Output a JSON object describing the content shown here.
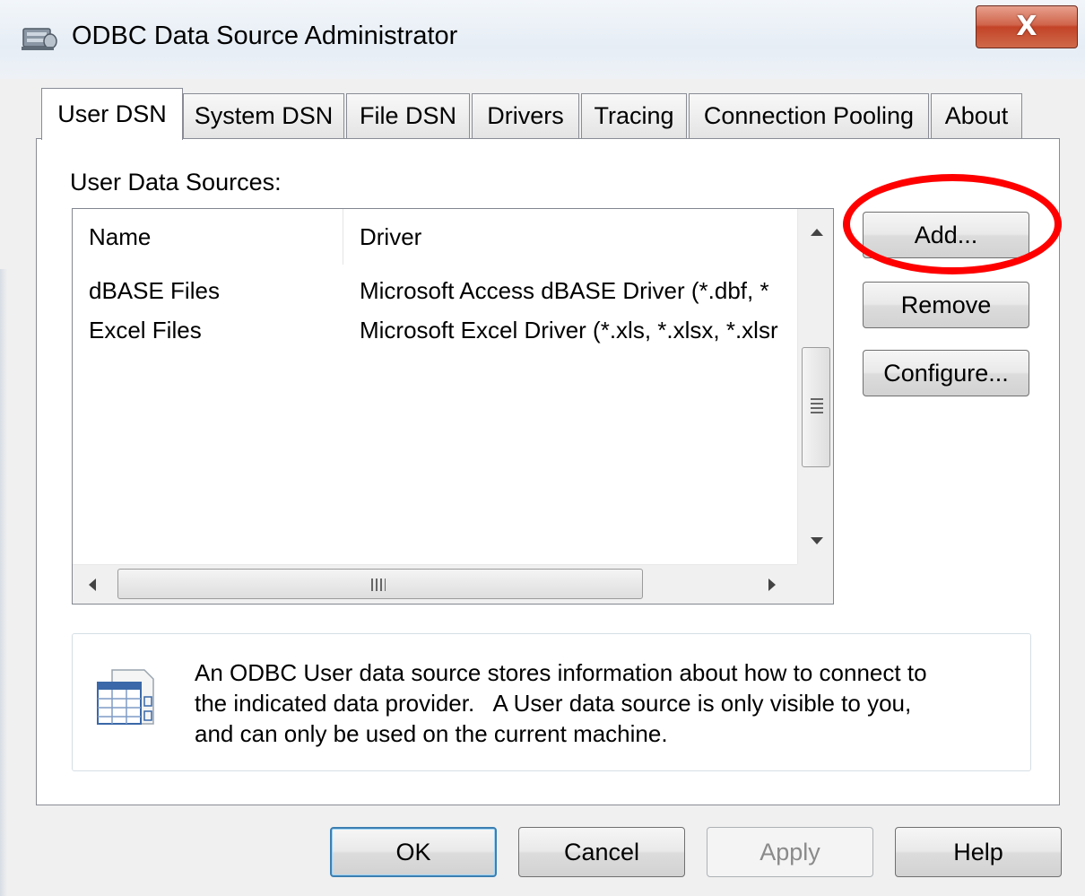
{
  "window": {
    "title": "ODBC Data Source Administrator",
    "close_label": "X"
  },
  "tabs": [
    {
      "label": "User DSN",
      "active": true
    },
    {
      "label": "System DSN",
      "active": false
    },
    {
      "label": "File DSN",
      "active": false
    },
    {
      "label": "Drivers",
      "active": false
    },
    {
      "label": "Tracing",
      "active": false
    },
    {
      "label": "Connection Pooling",
      "active": false
    },
    {
      "label": "About",
      "active": false
    }
  ],
  "user_dsn": {
    "section_label": "User Data Sources:",
    "columns": {
      "name": "Name",
      "driver": "Driver"
    },
    "rows": [
      {
        "name": "dBASE Files",
        "driver": "Microsoft Access dBASE Driver (*.dbf, *"
      },
      {
        "name": "Excel Files",
        "driver": "Microsoft Excel Driver (*.xls, *.xlsx, *.xlsr"
      }
    ],
    "buttons": {
      "add": "Add...",
      "remove": "Remove",
      "configure": "Configure..."
    },
    "info_lines": [
      "An ODBC User data source stores information about how to connect to",
      "the indicated data provider.   A User data source is only visible to you,",
      "and can only be used on the current machine."
    ]
  },
  "footer": {
    "ok": "OK",
    "cancel": "Cancel",
    "apply": "Apply",
    "help": "Help"
  },
  "colors": {
    "highlight_ring": "#ff0000",
    "close_button": "#c34327",
    "default_button_border": "#3c7fb1"
  },
  "icons": {
    "title": "odbc-admin-icon",
    "info": "data-source-table-icon"
  }
}
